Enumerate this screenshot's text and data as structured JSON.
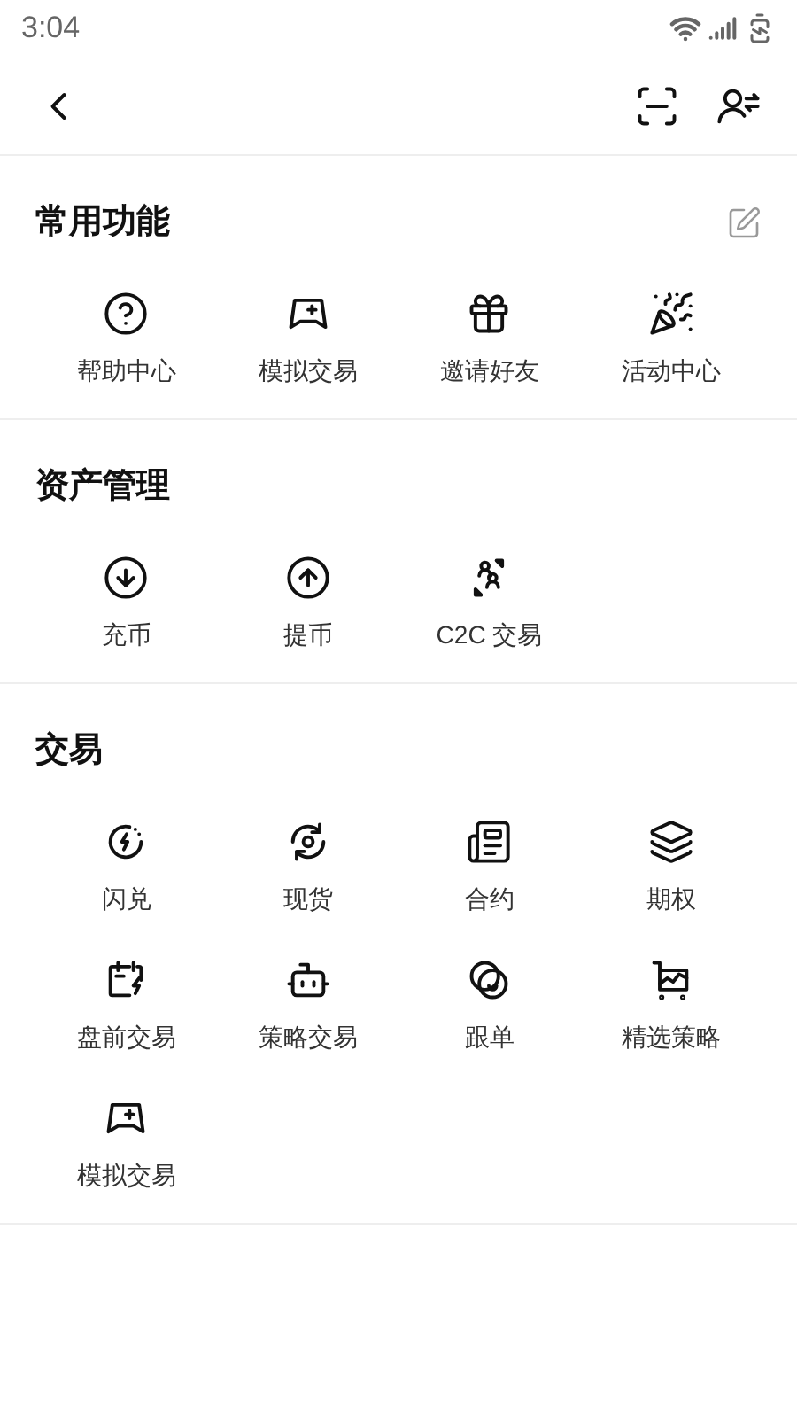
{
  "status_bar": {
    "time": "3:04"
  },
  "sections": [
    {
      "title": "常用功能",
      "editable": true,
      "items": [
        {
          "label": "帮助中心"
        },
        {
          "label": "模拟交易"
        },
        {
          "label": "邀请好友"
        },
        {
          "label": "活动中心"
        }
      ]
    },
    {
      "title": "资产管理",
      "editable": false,
      "items": [
        {
          "label": "充币"
        },
        {
          "label": "提币"
        },
        {
          "label": "C2C 交易"
        }
      ]
    },
    {
      "title": "交易",
      "editable": false,
      "items": [
        {
          "label": "闪兑"
        },
        {
          "label": "现货"
        },
        {
          "label": "合约"
        },
        {
          "label": "期权"
        },
        {
          "label": "盘前交易"
        },
        {
          "label": "策略交易"
        },
        {
          "label": "跟单"
        },
        {
          "label": "精选策略"
        },
        {
          "label": "模拟交易"
        }
      ]
    }
  ]
}
